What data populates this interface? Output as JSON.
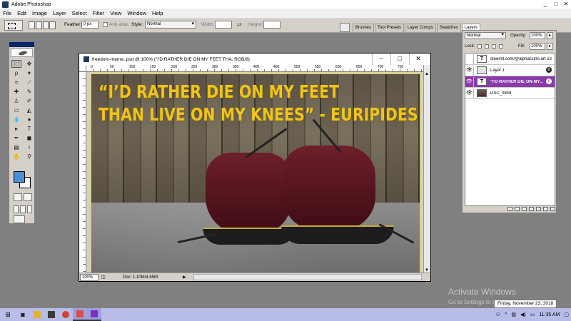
{
  "window": {
    "title": "Adobe Photoshop",
    "min": "_",
    "max": "□",
    "close": "✕"
  },
  "menu": [
    "File",
    "Edit",
    "Image",
    "Layer",
    "Select",
    "Filter",
    "View",
    "Window",
    "Help"
  ],
  "options": {
    "feather_label": "Feather:",
    "feather_value": "0 px",
    "antialias_label": "Anti-alias",
    "style_label": "Style:",
    "style_value": "Normal",
    "width_label": "Width:",
    "height_label": "Height:"
  },
  "palette_tabs": [
    "Brushes",
    "Tool Presets",
    "Layer Comps",
    "Swatches",
    "Layers"
  ],
  "document": {
    "title": "freedom-meme..psd @ 100% (\"I'D RATHER DIE ON MY FEET THA, RGB/8)",
    "ruler_ticks": [
      "0",
      "50",
      "100",
      "150",
      "200",
      "250",
      "300",
      "350",
      "400",
      "450",
      "500",
      "550",
      "600",
      "650",
      "700",
      "750"
    ],
    "quote_line1": "“I’D RATHER DIE ON MY FEET",
    "quote_line2": "THAN LIVE ON MY KNEES” - EURIPIDES",
    "zoom": "100%",
    "doc_info": "Doc: 1.10M/4.65M"
  },
  "layers": {
    "blend_mode": "Normal",
    "opacity_label": "Opacity:",
    "opacity_value": "100%",
    "lock_label": "Lock:",
    "fill_label": "Fill:",
    "fill_value": "100%",
    "items": [
      {
        "name": "steemit.com/@alphaccino.art 23",
        "thumb": "T",
        "visible": false
      },
      {
        "name": "Layer 1",
        "thumb": "",
        "visible": true
      },
      {
        "name": "\"I'D RATHER DIE ON MY...",
        "thumb": "T",
        "visible": true,
        "selected": true
      },
      {
        "name": "DSC_0849",
        "thumb": "",
        "visible": true
      }
    ]
  },
  "watermark": {
    "line1": "Activate Windows",
    "line2": "Go to Settings to activate Windows."
  },
  "taskbar": {
    "date_tooltip": "Friday, November 23, 2018",
    "time": "11:35 AM"
  }
}
